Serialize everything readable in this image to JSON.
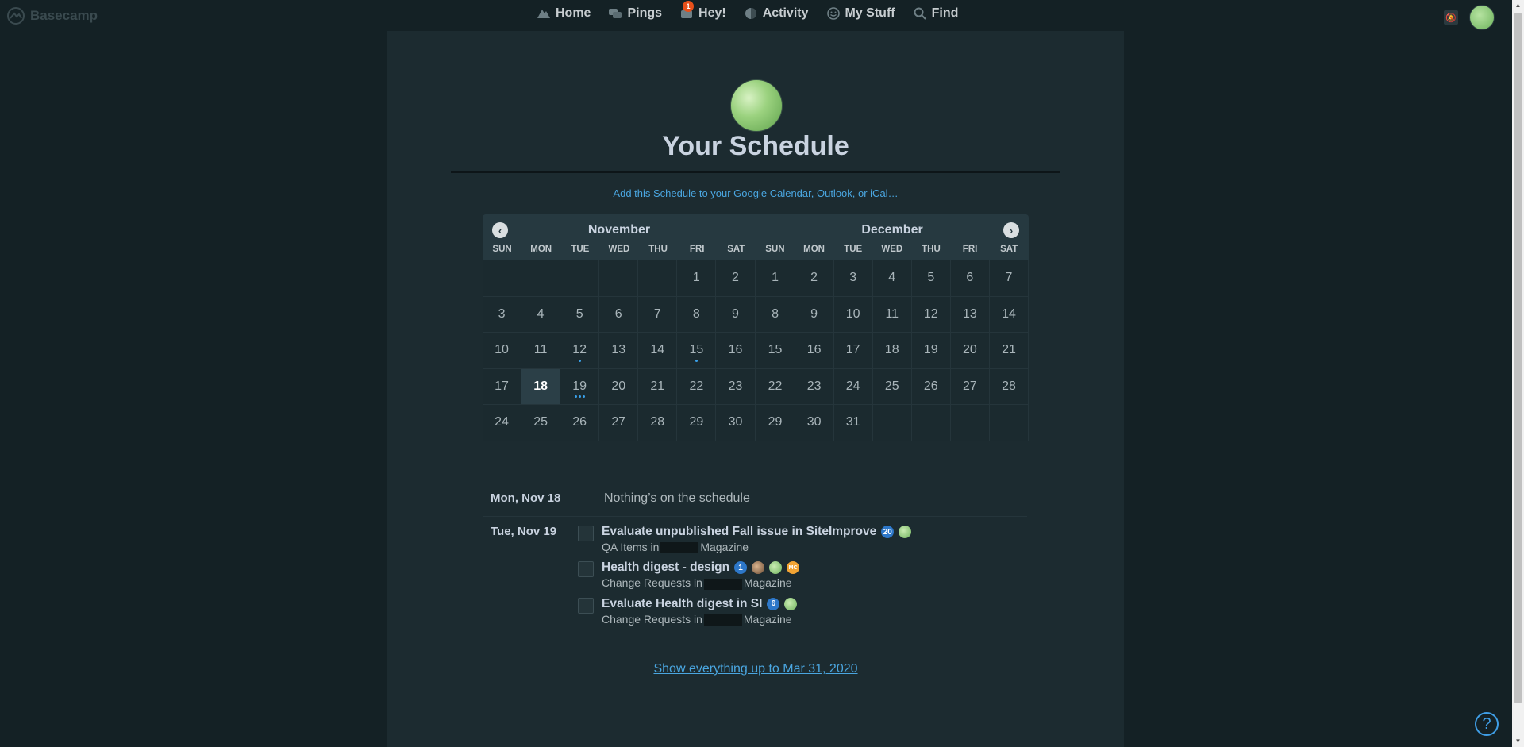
{
  "app": {
    "logo_text": "Basecamp"
  },
  "nav": {
    "items": [
      {
        "label": "Home",
        "icon": "mountain-icon"
      },
      {
        "label": "Pings",
        "icon": "chat-bubbles-icon"
      },
      {
        "label": "Hey!",
        "icon": "inbox-icon",
        "badge": "1"
      },
      {
        "label": "Activity",
        "icon": "activity-icon"
      },
      {
        "label": "My Stuff",
        "icon": "smiley-icon"
      },
      {
        "label": "Find",
        "icon": "search-icon"
      }
    ]
  },
  "page": {
    "title": "Your Schedule",
    "calendar_link": "Add this Schedule to your Google Calendar, Outlook, or iCal…",
    "show_all": "Show everything up to Mar 31, 2020"
  },
  "calendar": {
    "dow": [
      "SUN",
      "MON",
      "TUE",
      "WED",
      "THU",
      "FRI",
      "SAT"
    ],
    "months": [
      {
        "name": "November",
        "weeks": [
          [
            "",
            "",
            "",
            "",
            "",
            "1",
            "2"
          ],
          [
            "3",
            "4",
            "5",
            "6",
            "7",
            "8",
            "9"
          ],
          [
            "10",
            "11",
            "12",
            "13",
            "14",
            "15",
            "16"
          ],
          [
            "17",
            "18",
            "19",
            "20",
            "21",
            "22",
            "23"
          ],
          [
            "24",
            "25",
            "26",
            "27",
            "28",
            "29",
            "30"
          ]
        ],
        "today": "18",
        "event_dots": {
          "12": 1,
          "15": 1,
          "19": 3
        }
      },
      {
        "name": "December",
        "weeks": [
          [
            "1",
            "2",
            "3",
            "4",
            "5",
            "6",
            "7"
          ],
          [
            "8",
            "9",
            "10",
            "11",
            "12",
            "13",
            "14"
          ],
          [
            "15",
            "16",
            "17",
            "18",
            "19",
            "20",
            "21"
          ],
          [
            "22",
            "23",
            "24",
            "25",
            "26",
            "27",
            "28"
          ],
          [
            "29",
            "30",
            "31",
            "",
            "",
            "",
            ""
          ]
        ],
        "today": "",
        "event_dots": {}
      }
    ]
  },
  "schedule": {
    "days": [
      {
        "date": "Mon, Nov 18",
        "empty_text": "Nothing’s on the schedule",
        "todos": []
      },
      {
        "date": "Tue, Nov 19",
        "empty_text": "",
        "todos": [
          {
            "title": "Evaluate unpublished Fall issue in SiteImprove",
            "count": "20",
            "avatars": [
              "green"
            ],
            "list": "QA Items in",
            "project_suffix": "Magazine"
          },
          {
            "title": "Health digest - design",
            "count": "1",
            "avatars": [
              "brown",
              "green",
              "orange"
            ],
            "list": "Change Requests in",
            "project_suffix": "Magazine"
          },
          {
            "title": "Evaluate Health digest in SI",
            "count": "6",
            "avatars": [
              "green"
            ],
            "list": "Change Requests in",
            "project_suffix": "Magazine"
          }
        ]
      }
    ]
  },
  "avatar_initials": {
    "orange": "MC"
  },
  "help": {
    "label": "?"
  }
}
